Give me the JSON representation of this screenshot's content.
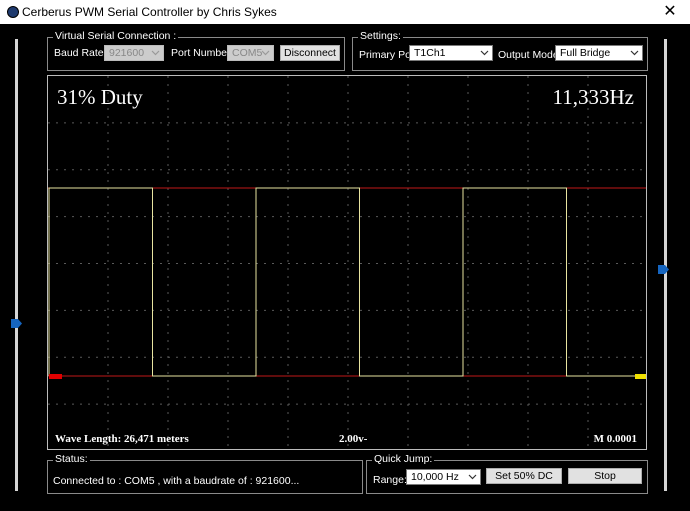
{
  "window": {
    "title": "Cerberus PWM Serial Controller by Chris Sykes",
    "close_glyph": "✕"
  },
  "serial": {
    "group_label": "Virtual Serial Connection :",
    "baud_label": "Baud Rate :",
    "baud_value": "921600",
    "port_label": "Port Number :",
    "port_value": "COM5",
    "disconnect_label": "Disconnect"
  },
  "settings": {
    "group_label": "Settings:",
    "primary_port_label": "Primary Port:",
    "primary_port_value": "T1Ch1",
    "output_mode_label": "Output Mode:",
    "output_mode_value": "Full Bridge"
  },
  "scope": {
    "duty_text": "31% Duty",
    "frequency_text": "11,333Hz",
    "wave_length_text": "Wave Length: 26,471 meters",
    "volts_text": "2.00v-",
    "m_text": "M 0.0001",
    "duty_fraction": 0.31,
    "cycles_visible": 5.75,
    "colors": {
      "trace": "#e8e4a0",
      "reference": "#c01818",
      "grid": "#5a5a5a",
      "marker_left": "#e00000",
      "marker_right": "#f0e000"
    }
  },
  "status": {
    "group_label": "Status:",
    "text": "Connected to : COM5 , with a baudrate of : 921600..."
  },
  "quick_jump": {
    "group_label": "Quick Jump:",
    "range_label": "Range:",
    "range_value": "10,000 Hz",
    "set50_label": "Set 50% DC",
    "stop_label": "Stop"
  },
  "sliders": {
    "left_level": 0.0,
    "right_level": 0.48,
    "thumb_color": "#1565c0"
  },
  "icons": {
    "app": "app-icon",
    "close": "close-icon",
    "dropdown": "chevron-down-icon"
  }
}
